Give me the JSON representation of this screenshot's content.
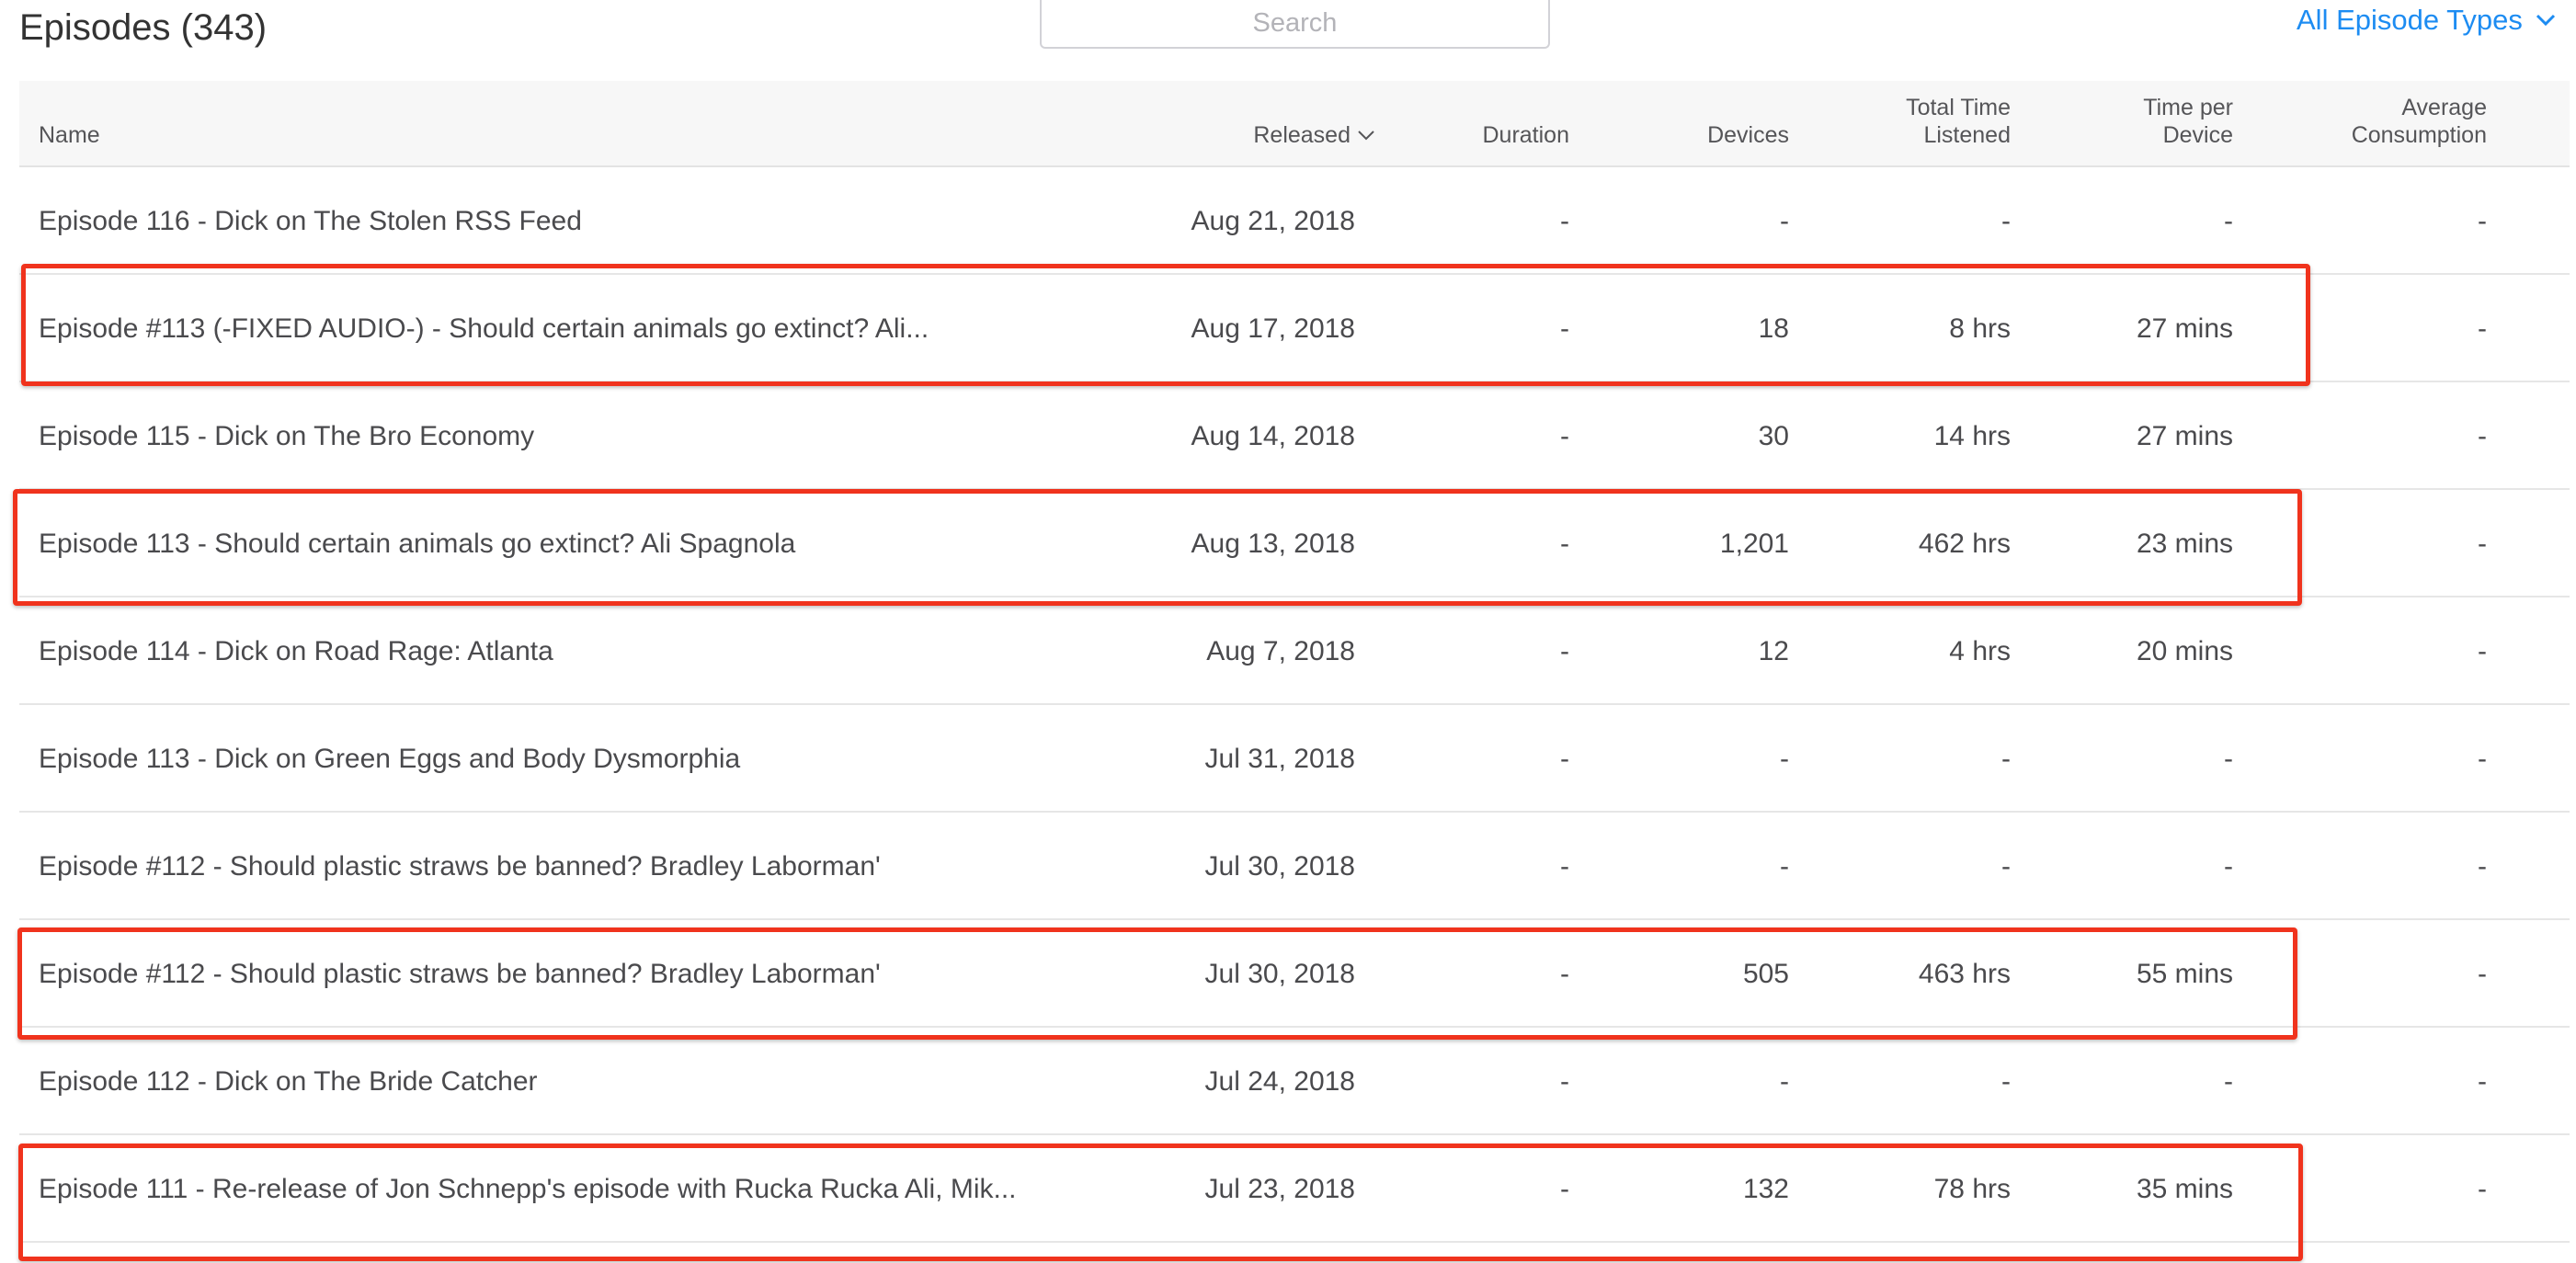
{
  "header": {
    "title": "Episodes (343)",
    "search_placeholder": "Search",
    "filter_label": "All Episode Types"
  },
  "columns": {
    "name": "Name",
    "released": "Released",
    "duration": "Duration",
    "devices": "Devices",
    "total_line1": "Total Time",
    "total_line2": "Listened",
    "tpd_line1": "Time per",
    "tpd_line2": "Device",
    "avg_line1": "Average",
    "avg_line2": "Consumption"
  },
  "rows": [
    {
      "name": "Episode 116 - Dick on The Stolen RSS Feed",
      "released": "Aug 21, 2018",
      "duration": "-",
      "devices": "-",
      "total": "-",
      "tpd": "-",
      "avg": "-"
    },
    {
      "name": "Episode #113 (-FIXED AUDIO-) - Should certain animals go extinct? Ali...",
      "released": "Aug 17, 2018",
      "duration": "-",
      "devices": "18",
      "total": "8 hrs",
      "tpd": "27 mins",
      "avg": "-"
    },
    {
      "name": "Episode 115 - Dick on The Bro Economy",
      "released": "Aug 14, 2018",
      "duration": "-",
      "devices": "30",
      "total": "14 hrs",
      "tpd": "27 mins",
      "avg": "-"
    },
    {
      "name": "Episode 113 - Should certain animals go extinct? Ali Spagnola",
      "released": "Aug 13, 2018",
      "duration": "-",
      "devices": "1,201",
      "total": "462 hrs",
      "tpd": "23 mins",
      "avg": "-"
    },
    {
      "name": "Episode 114 - Dick on Road Rage: Atlanta",
      "released": "Aug 7, 2018",
      "duration": "-",
      "devices": "12",
      "total": "4 hrs",
      "tpd": "20 mins",
      "avg": "-"
    },
    {
      "name": "Episode 113 - Dick on Green Eggs and Body Dysmorphia",
      "released": "Jul 31, 2018",
      "duration": "-",
      "devices": "-",
      "total": "-",
      "tpd": "-",
      "avg": "-"
    },
    {
      "name": "Episode #112 - Should plastic straws be banned? Bradley Laborman'",
      "released": "Jul 30, 2018",
      "duration": "-",
      "devices": "-",
      "total": "-",
      "tpd": "-",
      "avg": "-"
    },
    {
      "name": "Episode #112 - Should plastic straws be banned? Bradley Laborman'",
      "released": "Jul 30, 2018",
      "duration": "-",
      "devices": "505",
      "total": "463 hrs",
      "tpd": "55 mins",
      "avg": "-"
    },
    {
      "name": "Episode 112 - Dick on The Bride Catcher",
      "released": "Jul 24, 2018",
      "duration": "-",
      "devices": "-",
      "total": "-",
      "tpd": "-",
      "avg": "-"
    },
    {
      "name": "Episode 111 - Re-release of Jon Schnepp's episode with Rucka Rucka Ali, Mik...",
      "released": "Jul 23, 2018",
      "duration": "-",
      "devices": "132",
      "total": "78 hrs",
      "tpd": "35 mins",
      "avg": "-"
    }
  ],
  "colors": {
    "accent": "#1d8cf2",
    "highlight": "#f0331d",
    "header_bg": "#f7f7f7"
  }
}
